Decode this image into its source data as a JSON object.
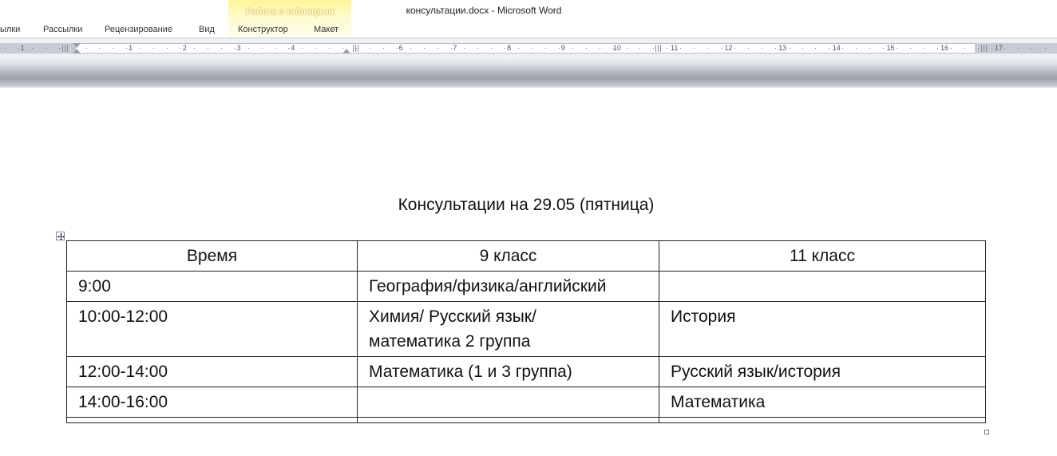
{
  "window": {
    "title": "консультации.docx  -  Microsoft Word"
  },
  "ribbon": {
    "tabs": [
      "ылки",
      "Рассылки",
      "Рецензирование",
      "Вид",
      "Конструктор",
      "Макет"
    ],
    "contextual_group_label": "Работа с таблицами",
    "contextual_group_color": "#fff59a"
  },
  "ruler": {
    "left_numbers": [
      "1"
    ],
    "numbers": [
      "1",
      "2",
      "3",
      "4",
      "6",
      "7",
      "8",
      "9",
      "10",
      "11",
      "12",
      "13",
      "14",
      "15",
      "16",
      "17"
    ]
  },
  "document": {
    "title": "Консультации на 29.05 (пятница)",
    "table": {
      "headers": [
        "Время",
        "9 класс",
        "11 класс"
      ],
      "rows": [
        [
          "9:00",
          "География/физика/английский",
          ""
        ],
        [
          "10:00-12:00",
          "Химия/ Русский язык/математика  2 группа",
          "История"
        ],
        [
          "12:00-14:00",
          "Математика  (1 и 3 группа)",
          "Русский язык/история"
        ],
        [
          "14:00-16:00",
          "",
          "Математика"
        ],
        [
          "",
          "",
          ""
        ]
      ]
    }
  }
}
